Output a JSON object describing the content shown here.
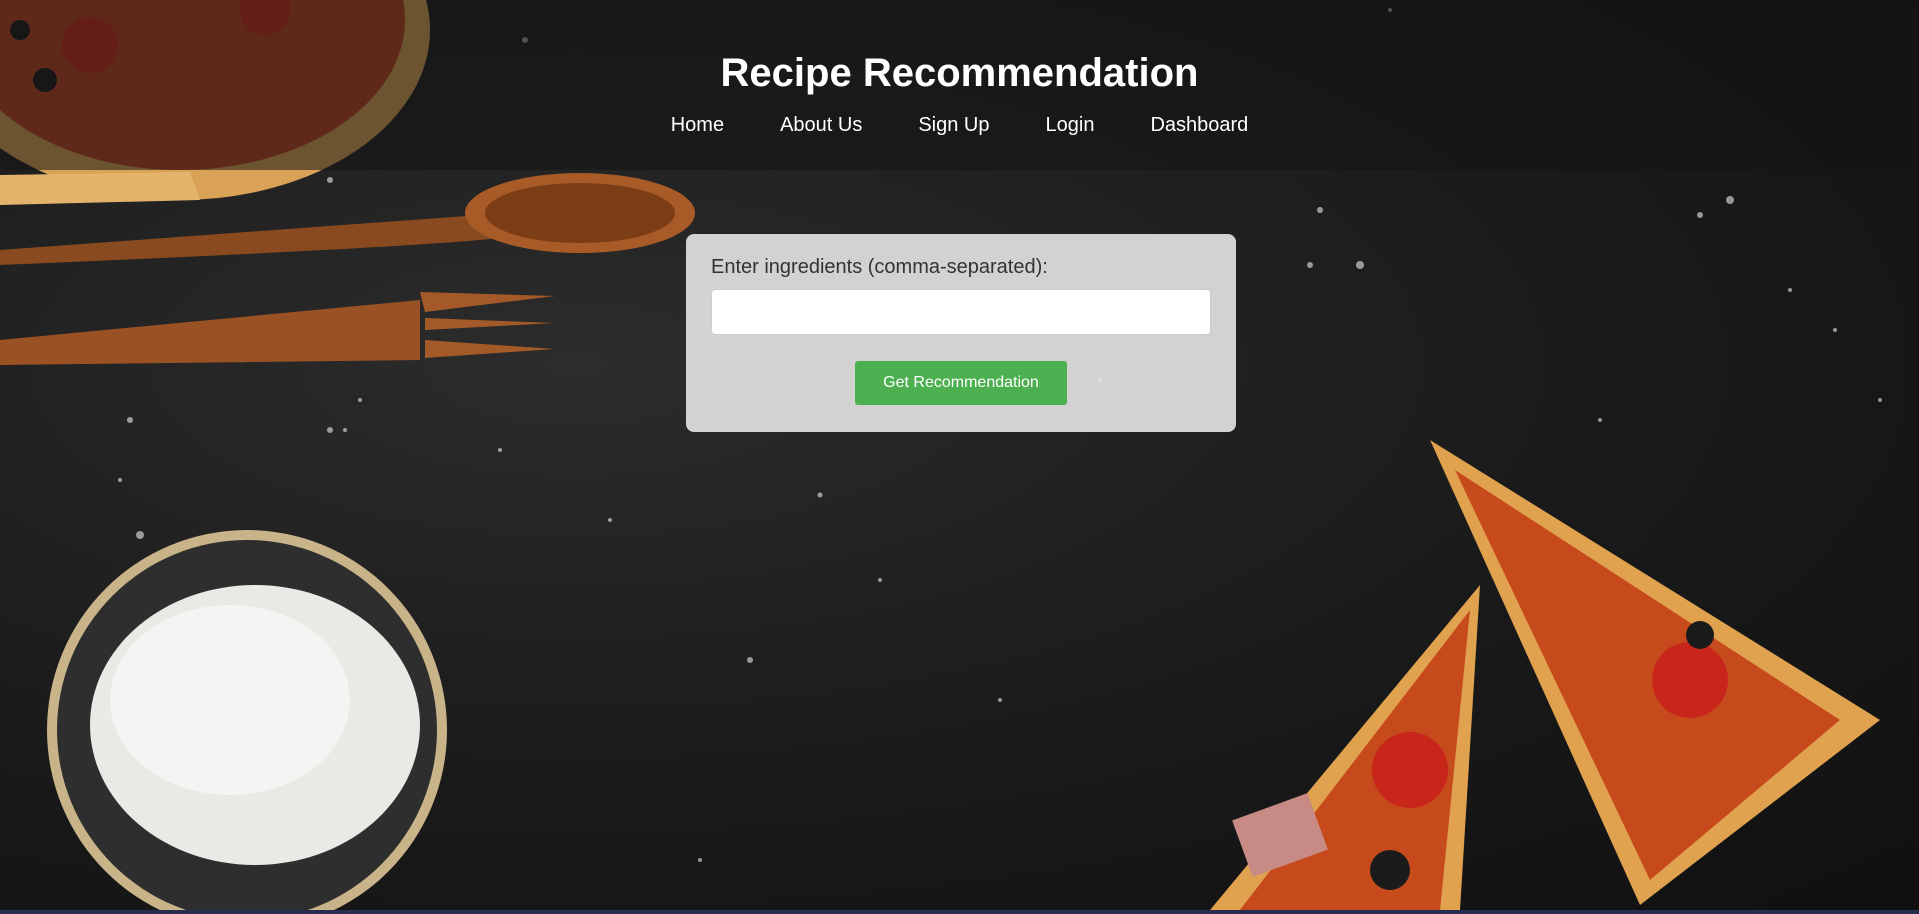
{
  "header": {
    "title": "Recipe Recommendation",
    "nav": [
      {
        "label": "Home"
      },
      {
        "label": "About Us"
      },
      {
        "label": "Sign Up"
      },
      {
        "label": "Login"
      },
      {
        "label": "Dashboard"
      }
    ]
  },
  "form": {
    "label": "Enter ingredients (comma-separated):",
    "input_value": "",
    "input_placeholder": "",
    "button_label": "Get Recommendation"
  },
  "colors": {
    "button": "#4caf50",
    "background": "#1a1a1a"
  },
  "background_image": {
    "items": [
      "pizza-icon",
      "wooden-spoon-icon",
      "wooden-fork-icon",
      "flour-bowl-icon",
      "pizza-slice-icon"
    ]
  }
}
